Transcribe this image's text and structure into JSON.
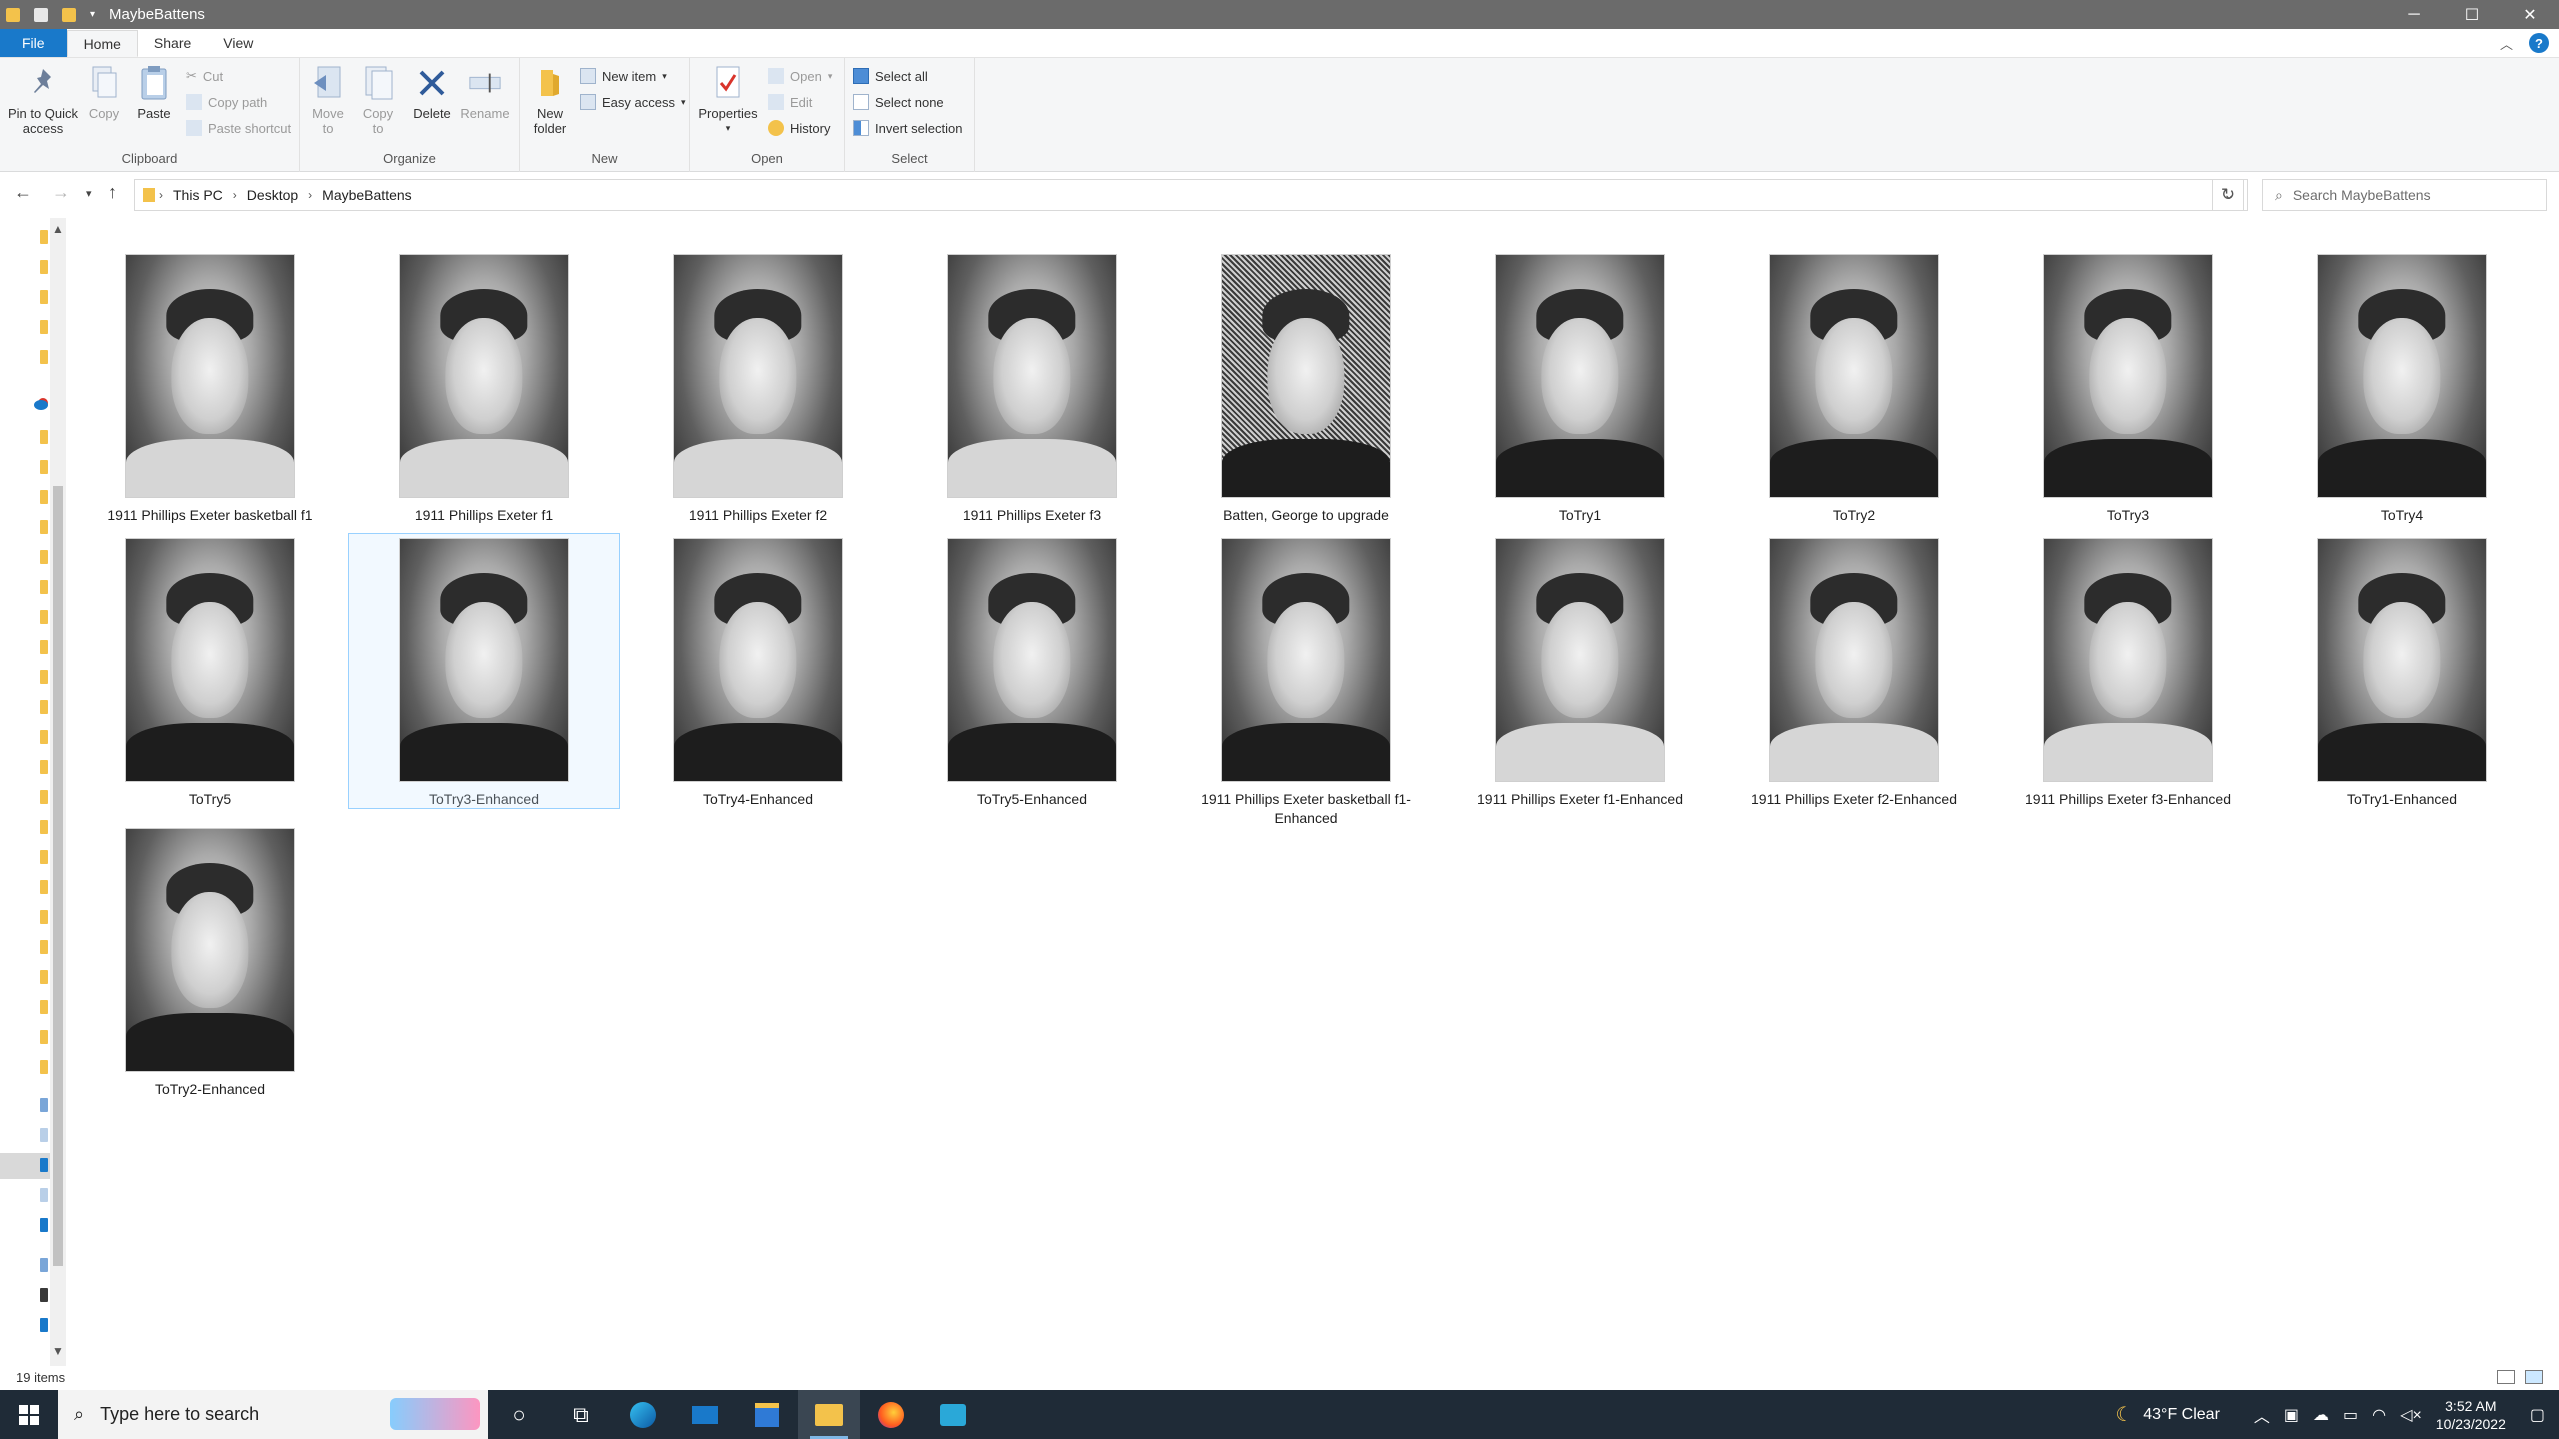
{
  "window": {
    "title": "MaybeBattens",
    "controls": {
      "minimize": "─",
      "maximize": "☐",
      "close": "✕"
    }
  },
  "ribbon_tabs": [
    {
      "label": "File"
    },
    {
      "label": "Home"
    },
    {
      "label": "Share"
    },
    {
      "label": "View"
    }
  ],
  "ribbon": {
    "clipboard": {
      "label": "Clipboard",
      "pin": "Pin to Quick access",
      "copy": "Copy",
      "paste": "Paste",
      "cut": "Cut",
      "copy_path": "Copy path",
      "paste_shortcut": "Paste shortcut"
    },
    "organize": {
      "label": "Organize",
      "move_to": "Move to",
      "copy_to": "Copy to",
      "delete": "Delete",
      "rename": "Rename"
    },
    "new": {
      "label": "New",
      "new_folder": "New folder",
      "new_item": "New item",
      "easy_access": "Easy access"
    },
    "open": {
      "label": "Open",
      "properties": "Properties",
      "open": "Open",
      "edit": "Edit",
      "history": "History"
    },
    "select": {
      "label": "Select",
      "select_all": "Select all",
      "select_none": "Select none",
      "invert": "Invert selection"
    }
  },
  "address": {
    "crumbs": [
      "This PC",
      "Desktop",
      "MaybeBattens"
    ],
    "search_placeholder": "Search MaybeBattens"
  },
  "files": [
    {
      "name": "1911  Phillips Exeter basketball f1",
      "tone": "light"
    },
    {
      "name": "1911  Phillips Exeter f1",
      "tone": "light"
    },
    {
      "name": "1911  Phillips Exeter f2",
      "tone": "light"
    },
    {
      "name": "1911  Phillips Exeter f3",
      "tone": "light"
    },
    {
      "name": "Batten, George to upgrade",
      "tone": "noisy"
    },
    {
      "name": "ToTry1",
      "tone": "dark"
    },
    {
      "name": "ToTry2",
      "tone": "dark"
    },
    {
      "name": "ToTry3",
      "tone": "dark"
    },
    {
      "name": "ToTry4",
      "tone": "dark"
    },
    {
      "name": "ToTry5",
      "tone": "dark"
    },
    {
      "name": "ToTry3-Enhanced",
      "tone": "dark",
      "selected": true
    },
    {
      "name": "ToTry4-Enhanced",
      "tone": "dark"
    },
    {
      "name": "ToTry5-Enhanced",
      "tone": "dark"
    },
    {
      "name": "1911  Phillips Exeter basketball f1-Enhanced",
      "tone": "dark"
    },
    {
      "name": "1911  Phillips Exeter f1-Enhanced",
      "tone": "light"
    },
    {
      "name": "1911  Phillips Exeter f2-Enhanced",
      "tone": "light"
    },
    {
      "name": "1911  Phillips Exeter f3-Enhanced",
      "tone": "light"
    },
    {
      "name": "ToTry1-Enhanced",
      "tone": "dark"
    },
    {
      "name": "ToTry2-Enhanced",
      "tone": "dark"
    }
  ],
  "status": {
    "count": "19 items"
  },
  "taskbar": {
    "search_placeholder": "Type here to search",
    "weather": "43°F  Clear",
    "time": "3:52 AM",
    "date": "10/23/2022"
  },
  "colors": {
    "accent": "#1979ca",
    "taskbar": "#1f2b37",
    "titlebar": "#6b6b6b"
  }
}
